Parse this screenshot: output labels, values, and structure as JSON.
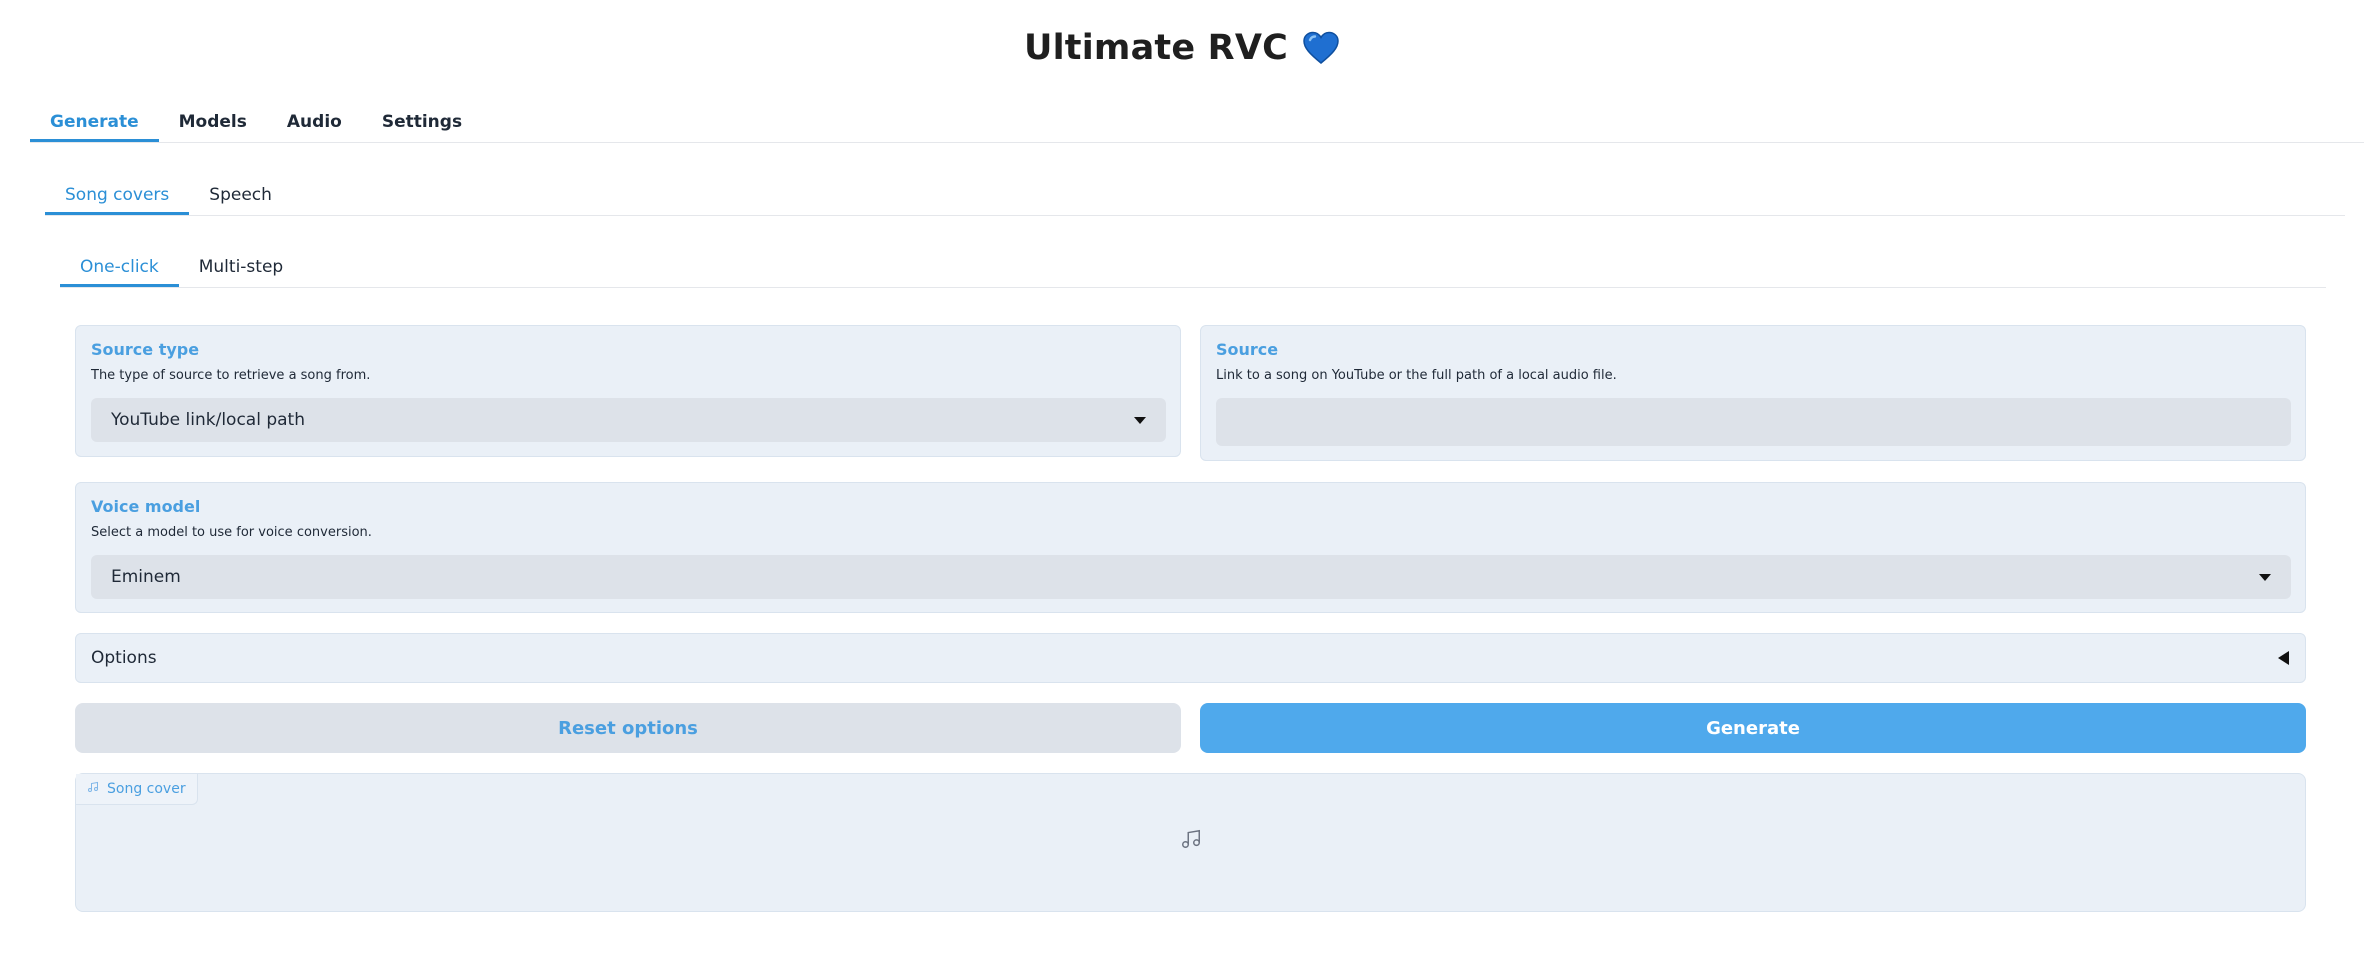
{
  "header": {
    "title": "Ultimate RVC",
    "emoji": "heart-icon"
  },
  "main_tabs": [
    {
      "label": "Generate",
      "active": true
    },
    {
      "label": "Models",
      "active": false
    },
    {
      "label": "Audio",
      "active": false
    },
    {
      "label": "Settings",
      "active": false
    }
  ],
  "sub_tabs": [
    {
      "label": "Song covers",
      "active": true
    },
    {
      "label": "Speech",
      "active": false
    }
  ],
  "mode_tabs": [
    {
      "label": "One-click",
      "active": true
    },
    {
      "label": "Multi-step",
      "active": false
    }
  ],
  "source_type": {
    "label": "Source type",
    "info": "The type of source to retrieve a song from.",
    "value": "YouTube link/local path"
  },
  "source": {
    "label": "Source",
    "info": "Link to a song on YouTube or the full path of a local audio file.",
    "value": ""
  },
  "voice_model": {
    "label": "Voice model",
    "info": "Select a model to use for voice conversion.",
    "value": "Eminem"
  },
  "options": {
    "label": "Options",
    "expanded": false
  },
  "buttons": {
    "reset": "Reset options",
    "generate": "Generate"
  },
  "output": {
    "label": "Song cover",
    "icon": "music-note-icon"
  },
  "colors": {
    "accent": "#2b8fd6",
    "primary_button": "#4fa9ec",
    "panel_bg": "#eaf0f7",
    "input_bg": "#dde2e9"
  }
}
